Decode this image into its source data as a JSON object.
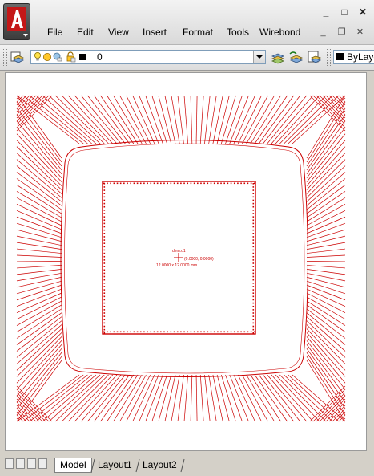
{
  "menu": {
    "items": [
      "File",
      "Edit",
      "View",
      "Insert",
      "Format",
      "Tools",
      "Wirebond"
    ]
  },
  "window_controls": {
    "minimize": "_",
    "maximize": "□",
    "close": "✕"
  },
  "document_controls": {
    "minimize": "_",
    "restore": "❐",
    "close": "✕"
  },
  "toolbar": {
    "layer_value": "0",
    "color_value": "ByLayer",
    "color_swatch": "#000000"
  },
  "drawing": {
    "line_color": "#cc0000",
    "die_name": "dem.o1",
    "die_origin": "(0.0000, 0.0000)",
    "die_size": "12.0000 x 12.0000 mm"
  },
  "tabs": [
    "Model",
    "Layout1",
    "Layout2"
  ]
}
